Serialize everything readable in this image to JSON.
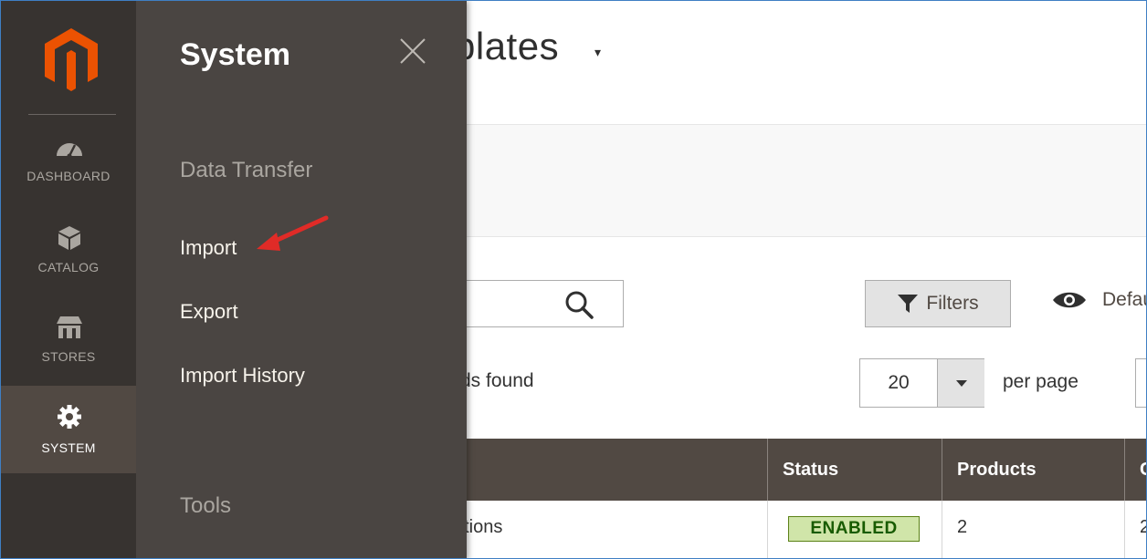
{
  "page": {
    "title": "plates",
    "title_caret": "▾"
  },
  "sidebar": {
    "items": [
      {
        "label": "DASHBOARD",
        "icon": "dashboard-icon"
      },
      {
        "label": "CATALOG",
        "icon": "catalog-icon"
      },
      {
        "label": "STORES",
        "icon": "stores-icon"
      },
      {
        "label": "SYSTEM",
        "icon": "gear-icon",
        "active": true
      }
    ]
  },
  "flyout": {
    "title": "System",
    "sections": [
      {
        "title": "Data Transfer",
        "items": [
          "Import",
          "Export",
          "Import History"
        ]
      },
      {
        "title": "Tools",
        "items": []
      }
    ]
  },
  "toolbar": {
    "filters_label": "Filters",
    "default_view_label": "Defau",
    "records_text": "rds found",
    "per_page_value": "20",
    "per_page_label": "per page"
  },
  "grid": {
    "columns": [
      "Status",
      "Products",
      "C"
    ],
    "rows": [
      {
        "name": "otions",
        "status": "ENABLED",
        "products": "2",
        "extra": "2"
      }
    ]
  },
  "colors": {
    "sidebar_bg": "#373330",
    "flyout_bg": "#4a4542",
    "grid_header_bg": "#514943",
    "accent_orange": "#eb5202",
    "annotation_arrow": "#e02b27",
    "status_enabled_bg": "#d0e5a9"
  }
}
